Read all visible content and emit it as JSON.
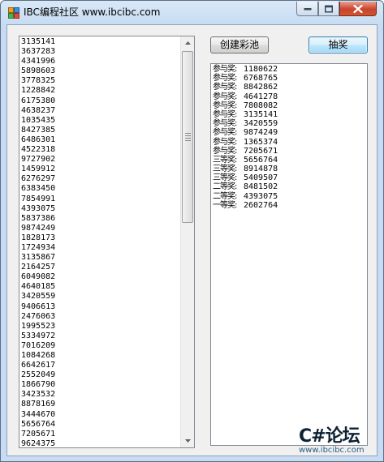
{
  "window": {
    "title": "IBC编程社区 www.ibcibc.com"
  },
  "list": {
    "items": [
      "3135141",
      "3637283",
      "4341996",
      "5898603",
      "3778325",
      "1228842",
      "6175380",
      "4638237",
      "1035435",
      "8427385",
      "6486301",
      "4522318",
      "9727902",
      "1459912",
      "6276297",
      "6383450",
      "7854991",
      "4393075",
      "5837386",
      "9874249",
      "1828173",
      "1724934",
      "3135867",
      "2164257",
      "6049082",
      "4640185",
      "3420559",
      "9406613",
      "2476063",
      "1995523",
      "5334972",
      "7016209",
      "1084268",
      "6642617",
      "2552049",
      "1866790",
      "3423532",
      "8878169",
      "3444670",
      "5656764",
      "7205671",
      "9624375"
    ]
  },
  "buttons": {
    "create_label": "创建彩池",
    "draw_label": "抽奖"
  },
  "results": [
    {
      "label": "参与奖:",
      "number": "1180622"
    },
    {
      "label": "参与奖:",
      "number": "6768765"
    },
    {
      "label": "参与奖:",
      "number": "8842862"
    },
    {
      "label": "参与奖:",
      "number": "4641278"
    },
    {
      "label": "参与奖:",
      "number": "7808082"
    },
    {
      "label": "参与奖:",
      "number": "3135141"
    },
    {
      "label": "参与奖:",
      "number": "3420559"
    },
    {
      "label": "参与奖:",
      "number": "9874249"
    },
    {
      "label": "参与奖:",
      "number": "1365374"
    },
    {
      "label": "参与奖:",
      "number": "7205671"
    },
    {
      "label": "三等奖:",
      "number": "5656764"
    },
    {
      "label": "三等奖:",
      "number": "8914878"
    },
    {
      "label": "三等奖:",
      "number": "5409507"
    },
    {
      "label": "二等奖:",
      "number": "8481502"
    },
    {
      "label": "二等奖:",
      "number": "4393075"
    },
    {
      "label": "一等奖:",
      "number": "2602764"
    }
  ],
  "watermark": {
    "main": "C#论坛",
    "url": "www.ibcibc.com"
  },
  "icons": {
    "app": "app-icon",
    "minimize": "minimize-icon",
    "maximize": "maximize-icon",
    "close": "close-icon"
  },
  "colors": {
    "close_button": "#c9442c",
    "default_button_border": "#3c7fb1"
  }
}
